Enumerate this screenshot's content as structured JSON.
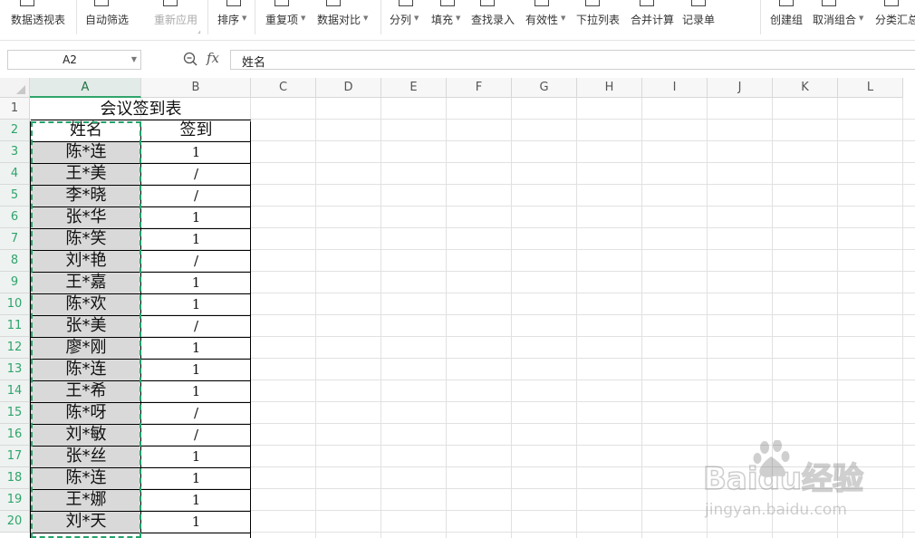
{
  "ribbon": {
    "items": [
      {
        "label": "数据透视表",
        "icon": "pivot-table-icon",
        "dropdown": false,
        "disabled": false
      },
      {
        "label": "自动筛选",
        "icon": "filter-icon",
        "dropdown": false,
        "disabled": false
      },
      {
        "label": "重新应用",
        "icon": "reapply-icon",
        "dropdown": false,
        "disabled": true
      },
      {
        "label": "排序",
        "icon": "sort-icon",
        "dropdown": true,
        "disabled": false
      },
      {
        "label": "重复项",
        "icon": "duplicates-icon",
        "dropdown": true,
        "disabled": false
      },
      {
        "label": "数据对比",
        "icon": "compare-icon",
        "dropdown": true,
        "disabled": false
      },
      {
        "label": "分列",
        "icon": "split-column-icon",
        "dropdown": true,
        "disabled": false
      },
      {
        "label": "填充",
        "icon": "fill-icon",
        "dropdown": true,
        "disabled": false
      },
      {
        "label": "查找录入",
        "icon": "lookup-entry-icon",
        "dropdown": false,
        "disabled": false
      },
      {
        "label": "有效性",
        "icon": "validation-icon",
        "dropdown": true,
        "disabled": false
      },
      {
        "label": "下拉列表",
        "icon": "dropdown-list-icon",
        "dropdown": false,
        "disabled": false
      },
      {
        "label": "合并计算",
        "icon": "consolidate-icon",
        "dropdown": false,
        "disabled": false
      },
      {
        "label": "记录单",
        "icon": "record-form-icon",
        "dropdown": false,
        "disabled": false
      },
      {
        "label": "创建组",
        "icon": "group-icon",
        "dropdown": false,
        "disabled": false
      },
      {
        "label": "取消组合",
        "icon": "ungroup-icon",
        "dropdown": true,
        "disabled": false
      },
      {
        "label": "分类汇总",
        "icon": "subtotal-icon",
        "dropdown": false,
        "disabled": false
      }
    ]
  },
  "formula_bar": {
    "cell_ref": "A2",
    "fx_label": "fx",
    "value": "姓名"
  },
  "sheet": {
    "columns": [
      "A",
      "B",
      "C",
      "D",
      "E",
      "F",
      "G",
      "H",
      "I",
      "J",
      "K",
      "L"
    ],
    "selected_column": "A",
    "rows": [
      "1",
      "2",
      "3",
      "4",
      "5",
      "6",
      "7",
      "8",
      "9",
      "10",
      "11",
      "12",
      "13",
      "14",
      "15",
      "16",
      "17",
      "18",
      "19",
      "20"
    ],
    "title": "会议签到表",
    "header": {
      "name": "姓名",
      "signin": "签到"
    },
    "records": [
      {
        "name": "陈*连",
        "signin": "1"
      },
      {
        "name": "王*美",
        "signin": "/"
      },
      {
        "name": "李*晓",
        "signin": "/"
      },
      {
        "name": "张*华",
        "signin": "1"
      },
      {
        "name": "陈*笑",
        "signin": "1"
      },
      {
        "name": "刘*艳",
        "signin": "/"
      },
      {
        "name": "王*嘉",
        "signin": "1"
      },
      {
        "name": "陈*欢",
        "signin": "1"
      },
      {
        "name": "张*美",
        "signin": "/"
      },
      {
        "name": "廖*刚",
        "signin": "1"
      },
      {
        "name": "陈*连",
        "signin": "1"
      },
      {
        "name": "王*希",
        "signin": "1"
      },
      {
        "name": "陈*呀",
        "signin": "/"
      },
      {
        "name": "刘*敏",
        "signin": "/"
      },
      {
        "name": "张*丝",
        "signin": "1"
      },
      {
        "name": "陈*连",
        "signin": "1"
      },
      {
        "name": "王*娜",
        "signin": "1"
      },
      {
        "name": "刘*天",
        "signin": "1"
      }
    ]
  },
  "watermark": {
    "brand": "Baidu经验",
    "url": "jingyan.baidu.com"
  },
  "colors": {
    "selection": "#23a36a",
    "shaded": "#d9d9d9",
    "grid": "#e1e1e1"
  }
}
